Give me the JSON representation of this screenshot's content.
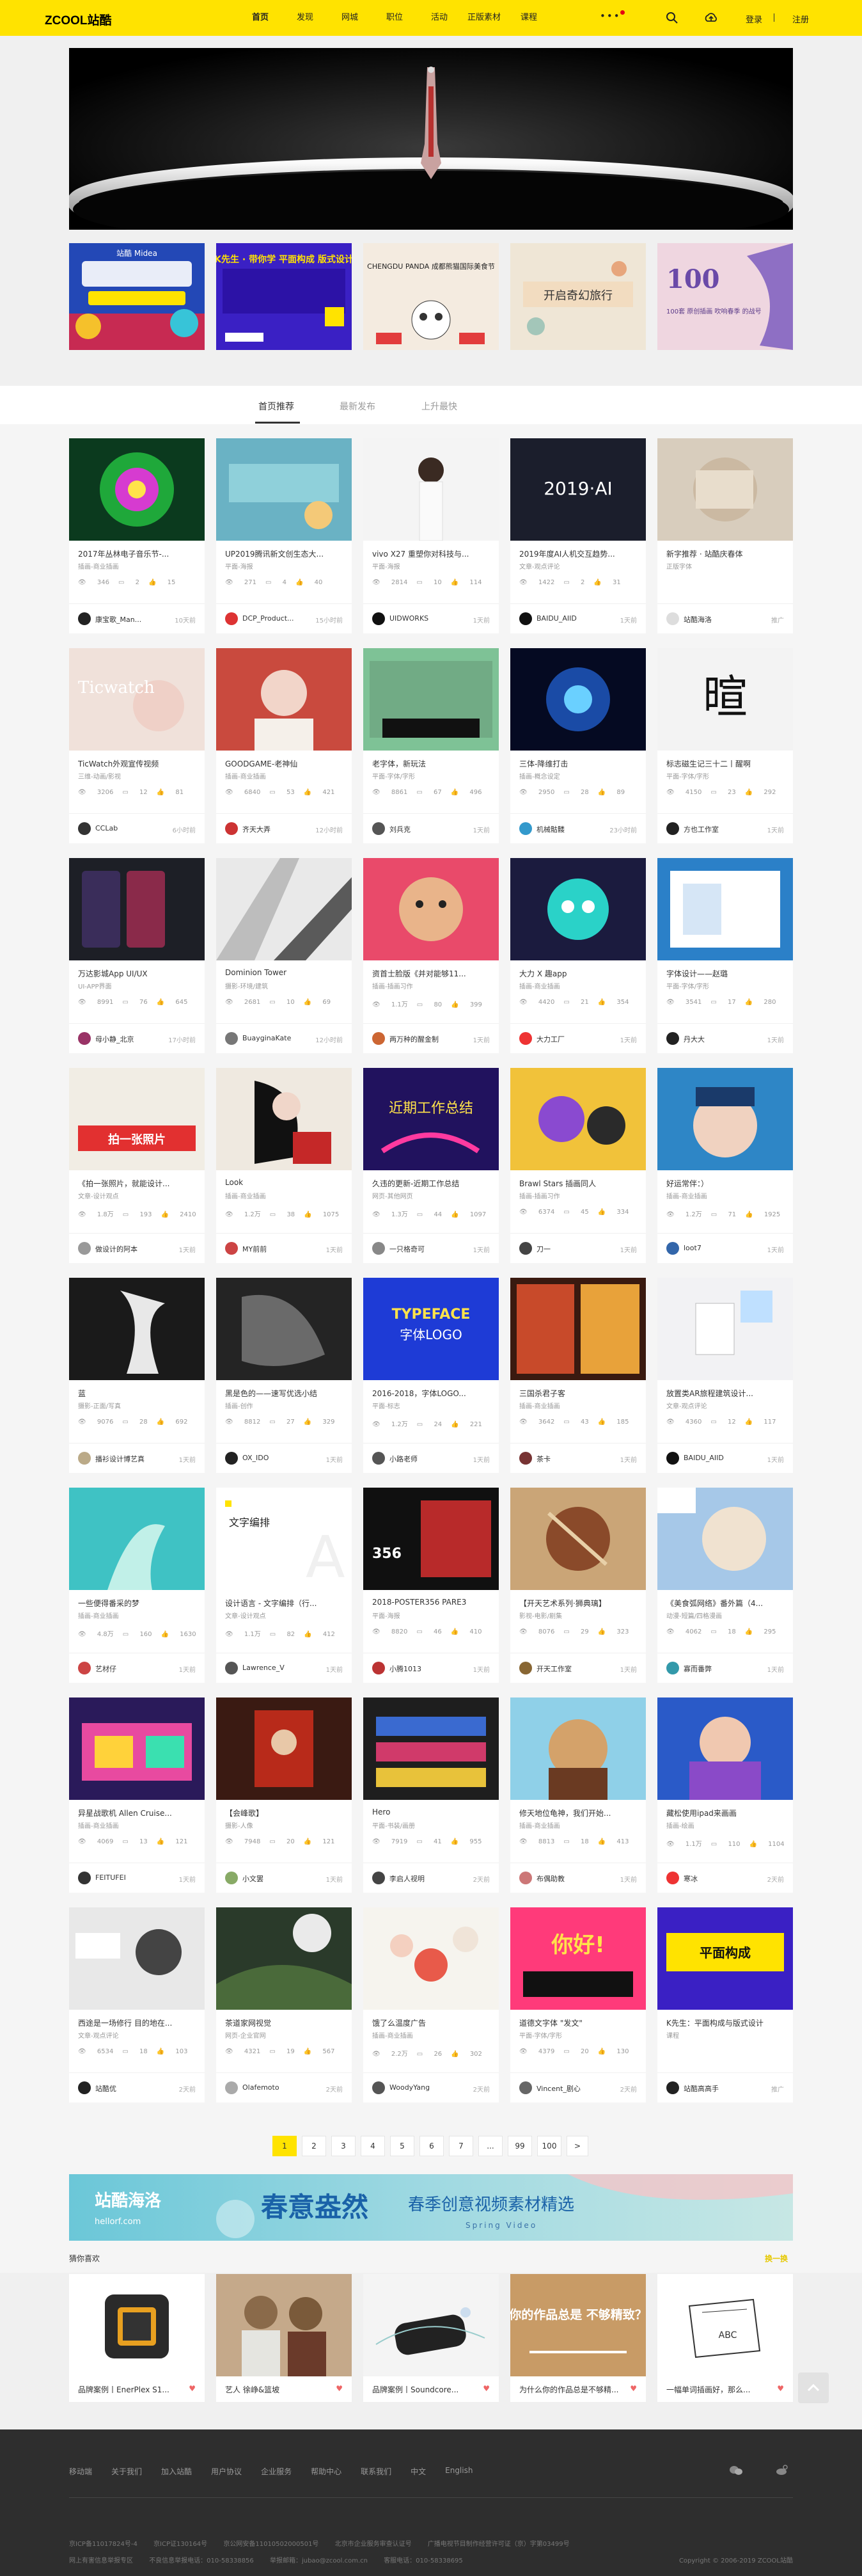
{
  "header": {
    "logo": "ZCOOL站酷",
    "nav": [
      "首页",
      "发现",
      "网城",
      "职位",
      "活动",
      "正版素材",
      "课程"
    ],
    "more": "•••",
    "login": "登录",
    "register": "注册"
  },
  "tabs": [
    "首页推荐",
    "最新发布",
    "上升最快"
  ],
  "cards": [
    {
      "title": "2017年丛林电子音乐节-...",
      "cat": "插画-商业插画",
      "views": "346",
      "comments": "2",
      "likes": "15",
      "author": "康宝歌_Man...",
      "time": "10天前",
      "av": "#222"
    },
    {
      "title": "UP2019腾讯新文创生态大...",
      "cat": "平面-海报",
      "views": "271",
      "comments": "4",
      "likes": "40",
      "author": "DCP_Product...",
      "time": "15小时前",
      "av": "#d33"
    },
    {
      "title": "vivo X27 重塑你对科技与...",
      "cat": "平面-海报",
      "views": "2814",
      "comments": "10",
      "likes": "114",
      "author": "UIDWORKS",
      "time": "1天前",
      "av": "#111"
    },
    {
      "title": "2019年度AI人机交互趋势...",
      "cat": "文章-观点评论",
      "views": "1422",
      "comments": "2",
      "likes": "31",
      "author": "BAIDU_AIID",
      "time": "1天前",
      "av": "#111"
    },
    {
      "title": "新字推荐 · 站酷庆春体",
      "cat": "正版字体",
      "views": "",
      "comments": "",
      "likes": "",
      "author": "站酷海洛",
      "time": "推广",
      "av": "#ddd"
    },
    {
      "title": "TicWatch外观宣传视频",
      "cat": "三维-动画/影视",
      "views": "3206",
      "comments": "12",
      "likes": "81",
      "author": "CCLab",
      "time": "6小时前",
      "av": "#333"
    },
    {
      "title": "GOODGAME-老神仙",
      "cat": "插画-商业插画",
      "views": "6840",
      "comments": "53",
      "likes": "421",
      "author": "齐天大弄",
      "time": "12小时前",
      "av": "#c33"
    },
    {
      "title": "老字体，新玩法",
      "cat": "平面-字体/字形",
      "views": "8861",
      "comments": "67",
      "likes": "496",
      "author": "刘兵克",
      "time": "1天前",
      "av": "#555"
    },
    {
      "title": "三体-降维打击",
      "cat": "插画-概念设定",
      "views": "2950",
      "comments": "28",
      "likes": "89",
      "author": "机械骷髅",
      "time": "23小时前",
      "av": "#39c"
    },
    {
      "title": "标志磁生记三十二丨醒啊",
      "cat": "平面-字体/字形",
      "views": "4150",
      "comments": "23",
      "likes": "292",
      "author": "方也工作室",
      "time": "1天前",
      "av": "#222"
    },
    {
      "title": "万达影城App UI/UX",
      "cat": "UI-APP界面",
      "views": "8991",
      "comments": "76",
      "likes": "645",
      "author": "母小静_北京",
      "time": "17小时前",
      "av": "#936"
    },
    {
      "title": "Dominion Tower",
      "cat": "摄影-环境/建筑",
      "views": "2681",
      "comments": "10",
      "likes": "69",
      "author": "BuayginaKate",
      "time": "12小时前",
      "av": "#777"
    },
    {
      "title": "资首士脸版《并对能够11...",
      "cat": "插画-插画习作",
      "views": "1.1万",
      "comments": "80",
      "likes": "399",
      "author": "两万种的醒金制",
      "time": "1天前",
      "av": "#c63"
    },
    {
      "title": "大力 X 趣app",
      "cat": "插画-商业插画",
      "views": "4420",
      "comments": "21",
      "likes": "354",
      "author": "大力工厂",
      "time": "1天前",
      "av": "#e33"
    },
    {
      "title": "字体设计——赵璐",
      "cat": "平面-字体/字形",
      "views": "3541",
      "comments": "17",
      "likes": "280",
      "author": "丹大大",
      "time": "1天前",
      "av": "#222"
    },
    {
      "title": "《拍一张照片，就能设计...",
      "cat": "文章-设计观点",
      "views": "1.8万",
      "comments": "193",
      "likes": "2410",
      "author": "做设计的阿本",
      "time": "1天前",
      "av": "#999"
    },
    {
      "title": "Look",
      "cat": "插画-商业插画",
      "views": "1.2万",
      "comments": "38",
      "likes": "1075",
      "author": "MY前前",
      "time": "1天前",
      "av": "#c44"
    },
    {
      "title": "久违的更新-近期工作总结",
      "cat": "网页-其他网页",
      "views": "1.3万",
      "comments": "44",
      "likes": "1097",
      "author": "一只格奇可",
      "time": "1天前",
      "av": "#888"
    },
    {
      "title": "Brawl Stars 插画同人",
      "cat": "插画-插画习作",
      "views": "6374",
      "comments": "45",
      "likes": "334",
      "author": "刀一",
      "time": "1天前",
      "av": "#444"
    },
    {
      "title": "好运常伴：）",
      "cat": "插画-商业插画",
      "views": "1.2万",
      "comments": "71",
      "likes": "1925",
      "author": "loot7",
      "time": "1天前",
      "av": "#36a"
    },
    {
      "title": "蓝",
      "cat": "摄影-正面/写真",
      "views": "9076",
      "comments": "28",
      "likes": "692",
      "author": "播衫设计博艺真",
      "time": "1天前",
      "av": "#ba8"
    },
    {
      "title": "黑是色的——速写优选小结",
      "cat": "插画-创作",
      "views": "8812",
      "comments": "27",
      "likes": "329",
      "author": "OX_IDO",
      "time": "1天前",
      "av": "#222"
    },
    {
      "title": "2016-2018，字体LOGO...",
      "cat": "平面-标志",
      "views": "1.2万",
      "comments": "24",
      "likes": "221",
      "author": "小路老师",
      "time": "1天前",
      "av": "#555"
    },
    {
      "title": "三国杀君子客",
      "cat": "插画-商业插画",
      "views": "3642",
      "comments": "43",
      "likes": "185",
      "author": "茶卡",
      "time": "1天前",
      "av": "#733"
    },
    {
      "title": "放置类AR旅程建筑设计...",
      "cat": "文章-观点评论",
      "views": "4360",
      "comments": "12",
      "likes": "117",
      "author": "BAIDU_AIID",
      "time": "1天前",
      "av": "#111"
    },
    {
      "title": "一些便得番采的梦",
      "cat": "插画-商业插画",
      "views": "4.8万",
      "comments": "160",
      "likes": "1630",
      "author": "艺材仔",
      "time": "1天前",
      "av": "#c44"
    },
    {
      "title": "设计语言 - 文字编排（行...",
      "cat": "文章-设计观点",
      "views": "1.1万",
      "comments": "82",
      "likes": "412",
      "author": "Lawrence_V",
      "time": "1天前",
      "av": "#555"
    },
    {
      "title": "2018-POSTER356 PARE3",
      "cat": "平面-海报",
      "views": "8820",
      "comments": "46",
      "likes": "410",
      "author": "小腾1013",
      "time": "1天前",
      "av": "#b33"
    },
    {
      "title": "【开天艺术系列·狮典璃】",
      "cat": "影视-电影/剧集",
      "views": "8076",
      "comments": "29",
      "likes": "323",
      "author": "开天工作室",
      "time": "1天前",
      "av": "#863"
    },
    {
      "title": "《美食弧网络》番外篇（4...",
      "cat": "动漫-短篇/四格漫画",
      "views": "4062",
      "comments": "18",
      "likes": "295",
      "author": "寡而番弊",
      "time": "1天前",
      "av": "#39a"
    },
    {
      "title": "异星战歌机 Allen Cruise...",
      "cat": "插画-商业插画",
      "views": "4069",
      "comments": "13",
      "likes": "121",
      "author": "FEITUFEI",
      "time": "1天前",
      "av": "#333"
    },
    {
      "title": "【会峰歌】",
      "cat": "摄影-人像",
      "views": "7948",
      "comments": "20",
      "likes": "121",
      "author": "小文罢",
      "time": "1天前",
      "av": "#8a6"
    },
    {
      "title": "Hero",
      "cat": "平面-书装/画册",
      "views": "7919",
      "comments": "41",
      "likes": "955",
      "author": "李启人视明",
      "time": "2天前",
      "av": "#444"
    },
    {
      "title": "修天地位龟神，我们开始...",
      "cat": "插画-商业插画",
      "views": "8813",
      "comments": "18",
      "likes": "413",
      "author": "布偶助教",
      "time": "1天前",
      "av": "#c77"
    },
    {
      "title": "藏松使用ipad来画画",
      "cat": "插画-绘画",
      "views": "1.1万",
      "comments": "110",
      "likes": "1104",
      "author": "寒冰",
      "time": "2天前",
      "av": "#e33"
    },
    {
      "title": "西途是一场修行 目的地在...",
      "cat": "文章-观点评论",
      "views": "6534",
      "comments": "18",
      "likes": "103",
      "author": "站酷优",
      "time": "2天前",
      "av": "#222"
    },
    {
      "title": "茶道家网视觉",
      "cat": "网页-企业官网",
      "views": "4321",
      "comments": "19",
      "likes": "567",
      "author": "Olafemoto",
      "time": "2天前",
      "av": "#aaa"
    },
    {
      "title": "饿了么温度广告",
      "cat": "插画-商业插画",
      "views": "2.2万",
      "comments": "26",
      "likes": "302",
      "author": "WoodyYang",
      "time": "2天前",
      "av": "#555"
    },
    {
      "title": "道德文字体 \"发文\"",
      "cat": "平面-字体/字形",
      "views": "4379",
      "comments": "20",
      "likes": "130",
      "author": "Vincent_剧心",
      "time": "2天前",
      "av": "#666"
    },
    {
      "title": "K先生：平面构成与版式设计",
      "cat": "课程",
      "views": "",
      "comments": "",
      "likes": "",
      "author": "站酷高高手",
      "time": "推广",
      "av": "#222"
    }
  ],
  "pager": [
    "1",
    "2",
    "3",
    "4",
    "5",
    "6",
    "7",
    "...",
    "99",
    "100",
    ">"
  ],
  "banner": {
    "brand": "站酷海洛",
    "brand_url": "hellorf.com",
    "title": "春意盎然",
    "subtitle": "春季创意视频素材精选",
    "en": "Spring Video"
  },
  "guess": {
    "label": "猜你喜欢",
    "change": "换一换"
  },
  "guess_cards": [
    {
      "title": "品牌案例丨EnerPlex S1..."
    },
    {
      "title": "艺人 徐峥&篮坡"
    },
    {
      "title": "品牌案例丨Soundcore..."
    },
    {
      "title": "为什么你的作品总是不够精..."
    },
    {
      "title": "一幅单词插画好，那么..."
    }
  ],
  "thumb_texts": {
    "g8_text": "你的作品总是\n不够精致？",
    "g9_text": "ABC",
    "hero_text": "",
    "sub1": "站酷 Midea",
    "sub2": "K先生 · 带你学 平面构成 版式设计",
    "sub3": "CHENGDU PANDA 成都熊猫国际美食节",
    "sub4": "开启奇幻旅行",
    "sub5": "100套 原创插画 吹响春季 的战号"
  },
  "footer": {
    "links": [
      "移动端",
      "关于我们",
      "加入站酷",
      "用户协议",
      "企业服务",
      "帮助中心",
      "联系我们",
      "中文",
      "English"
    ],
    "legal1": [
      "京ICP备11017824号-4",
      "京ICP证130164号",
      "京公网安备11010502000501号",
      "北京市企业服务审查认证号",
      "广播电视节目制作经营许可证（京）字第03499号"
    ],
    "legal2": [
      "网上有害信息举报专区",
      "不良信息举报电话：010-58338856",
      "举报邮箱：jubao@zcool.com.cn",
      "客服电话：010-58338695"
    ],
    "copyright": "Copyright © 2006-2019 ZCOOL站酷"
  }
}
